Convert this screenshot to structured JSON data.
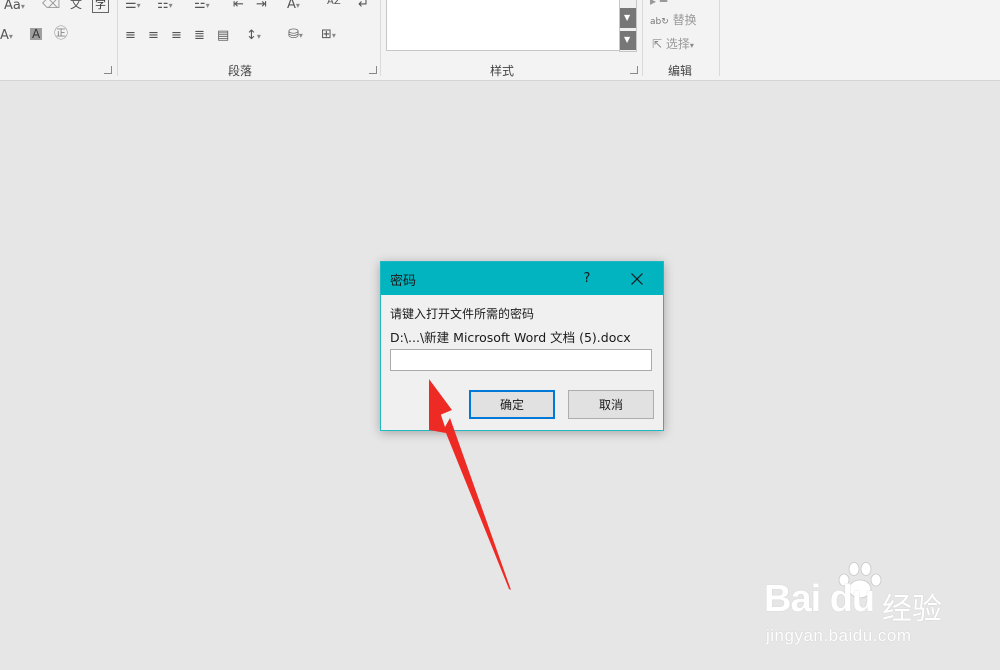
{
  "ribbon": {
    "font_group": {
      "change_case": "Aa",
      "phonetic": "文",
      "font_color_letter": "A",
      "highlight_letter": "A",
      "char_shading_letter": "A",
      "enclosed_char": "字"
    },
    "paragraph_group": {
      "label": "段落"
    },
    "styles_group": {
      "label": "样式"
    },
    "editing_group": {
      "label": "编辑",
      "replace_label": "替换",
      "select_label": "选择"
    },
    "sort_icon_text": "AZ"
  },
  "dialog": {
    "title": "密码",
    "help_label": "?",
    "prompt": "请键入打开文件所需的密码",
    "file_path": "D:\\...\\新建 Microsoft Word 文档 (5).docx",
    "password_value": "",
    "ok_label": "确定",
    "cancel_label": "取消"
  },
  "annotation": {
    "color": "#ee2a24"
  },
  "watermark": {
    "brand": "Bai du",
    "cn": "经验",
    "url": "jingyan.baidu.com"
  },
  "colors": {
    "titlebar": "#01b4c0",
    "ok_border": "#0078d7",
    "background": "#e6e6e6"
  }
}
